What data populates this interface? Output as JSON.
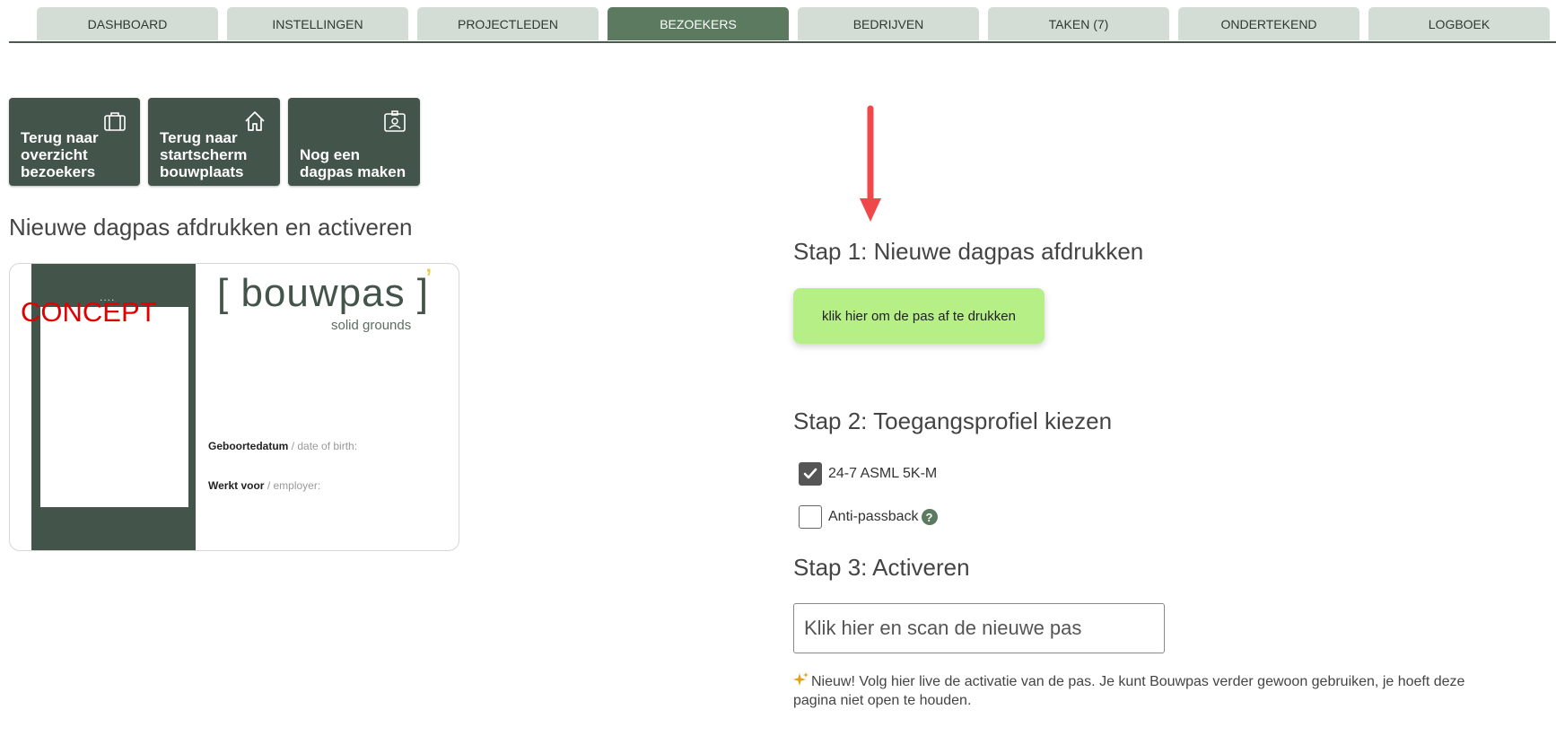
{
  "tabs": [
    {
      "label": "DASHBOARD"
    },
    {
      "label": "INSTELLINGEN"
    },
    {
      "label": "PROJECTLEDEN"
    },
    {
      "label": "BEZOEKERS",
      "active": true
    },
    {
      "label": "BEDRIJVEN"
    },
    {
      "label": "TAKEN (7)"
    },
    {
      "label": "ONDERTEKEND"
    },
    {
      "label": "LOGBOEK"
    }
  ],
  "actions": [
    {
      "label": "Terug naar\noverzicht\nbezoekers",
      "icon": "briefcase-icon"
    },
    {
      "label": "Terug naar\nstartscherm\nbouwplaats",
      "icon": "home-icon"
    },
    {
      "label": "Nog een\ndagpas maken",
      "icon": "id-badge-icon"
    }
  ],
  "left_heading": "Nieuwe dagpas afdrukken en activeren",
  "card": {
    "concept": "CONCEPT",
    "dots": "....",
    "logo_text": "[ bouwpas ]",
    "logo_mark": "’",
    "tagline": "solid grounds",
    "birth_label": "Geboortedatum",
    "birth_sub": "/ date of birth:",
    "employer_label": "Werkt voor",
    "employer_sub": "/ employer:"
  },
  "step1": {
    "title": "Stap 1: Nieuwe dagpas afdrukken",
    "button": "klik hier om de pas af te drukken"
  },
  "step2": {
    "title": "Stap 2: Toegangsprofiel kiezen",
    "options": [
      {
        "label": "24-7 ASML 5K-M",
        "checked": true
      },
      {
        "label": "Anti-passback",
        "checked": false
      }
    ],
    "help_glyph": "?"
  },
  "step3": {
    "title": "Stap 3: Activeren",
    "placeholder": "Klik hier en scan de nieuwe pas"
  },
  "note": "Nieuw! Volg hier live de activatie van de pas. Je kunt Bouwpas verder gewoon gebruiken, je hoeft deze pagina niet open te houden.",
  "colors": {
    "accent_green": "#5c7a5f",
    "tile_green": "#43544a",
    "print_button": "#b7ef87",
    "arrow": "#f04848",
    "concept": "#e00000",
    "spark": "#e2a21a"
  }
}
